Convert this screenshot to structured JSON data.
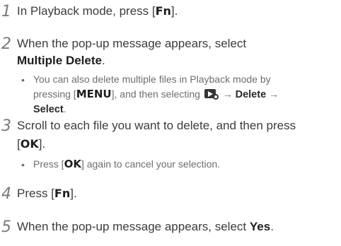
{
  "steps": [
    {
      "num": "1",
      "line1_pre": "In Playback mode, press [",
      "line1_key": "Fn",
      "line1_post": "]."
    },
    {
      "num": "2",
      "line1": "When the pop-up message appears, select",
      "line2_bold": "Multiple Delete",
      "line2_post": ".",
      "bullet": {
        "line1": "You can also delete multiple files in Playback mode by",
        "line2_pre": "pressing [",
        "line2_key": "MENU",
        "line2_mid": "], and then selecting",
        "line2_arrow1": " → ",
        "line2_bold1": "Delete",
        "line2_arrow2": " →",
        "line3_bold": "Select",
        "line3_post": "."
      }
    },
    {
      "num": "3",
      "line1": "Scroll to each file you want to delete, and then press",
      "line2_pre": "[",
      "line2_key": "OK",
      "line2_post": "].",
      "bullet": {
        "pre": "Press [",
        "key": "OK",
        "post": "] again to cancel your selection."
      }
    },
    {
      "num": "4",
      "line1_pre": "Press [",
      "line1_key": "Fn",
      "line1_post": "]."
    },
    {
      "num": "5",
      "line1_pre": "When the pop-up message appears, select ",
      "line1_bold": "Yes",
      "line1_post": "."
    }
  ],
  "icons": {
    "playback_settings": "playback-settings-icon"
  }
}
